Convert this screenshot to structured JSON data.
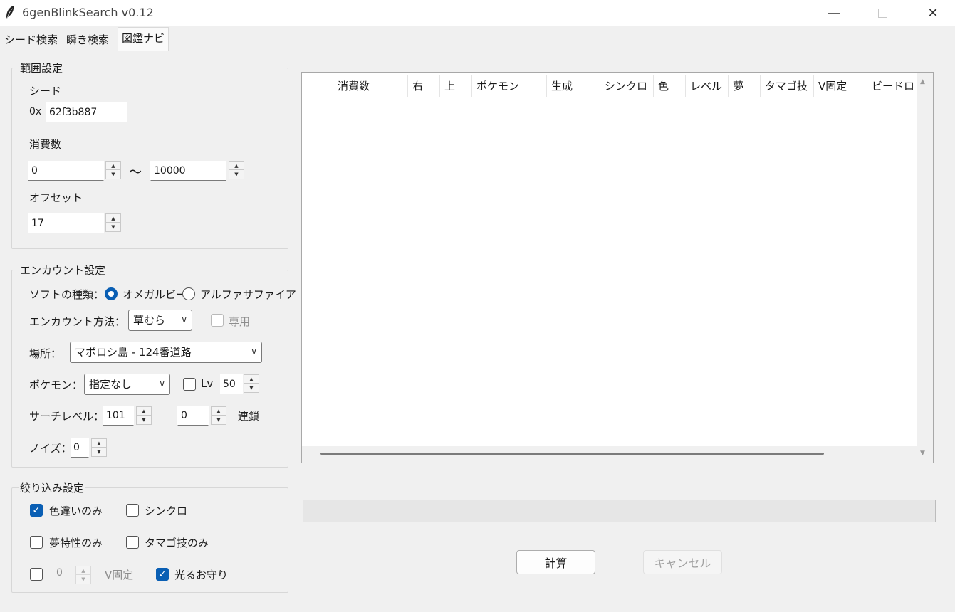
{
  "window": {
    "title": "6genBlinkSearch v0.12"
  },
  "tabs": [
    {
      "label": "シード検索"
    },
    {
      "label": "瞬き検索"
    },
    {
      "label": "図鑑ナビ"
    }
  ],
  "range": {
    "group_label": "範囲設定",
    "seed_label": "シード",
    "seed_prefix": "0x",
    "seed_value": "62f3b887",
    "consumption_label": "消費数",
    "consumption_min": "0",
    "tilde": "～",
    "consumption_max": "10000",
    "offset_label": "オフセット",
    "offset_value": "17"
  },
  "encounter": {
    "group_label": "エンカウント設定",
    "soft_label": "ソフトの種類：",
    "soft_options": [
      "オメガルビー",
      "アルファサファイア"
    ],
    "method_label": "エンカウント方法：",
    "method_value": "草むら",
    "exclusive_label": "専用",
    "place_label": "場所：",
    "place_value": "マボロシ島 - 124番道路",
    "pokemon_label": "ポケモン：",
    "pokemon_value": "指定なし",
    "lv_label": "Lv",
    "lv_value": "50",
    "search_level_label": "サーチレベル：",
    "search_level_value": "101",
    "chain_value": "0",
    "chain_label": "連鎖",
    "noise_label": "ノイズ：",
    "noise_value": "0"
  },
  "filter": {
    "group_label": "絞り込み設定",
    "shiny_only": "色違いのみ",
    "synchro": "シンクロ",
    "dream_only": "夢特性のみ",
    "egg_move_only": "タマゴ技のみ",
    "v_value": "0",
    "v_fixed": "V固定",
    "shiny_charm": "光るお守り"
  },
  "results": {
    "columns": [
      "消費数",
      "右",
      "上",
      "ポケモン",
      "生成",
      "シンクロ",
      "色",
      "レベル",
      "夢",
      "タマゴ技",
      "V固定",
      "ビードロ"
    ]
  },
  "actions": {
    "calculate": "計算",
    "cancel": "キャンセル"
  },
  "colors": {
    "accent": "#0a5fb4",
    "background": "#f0f0f0"
  }
}
